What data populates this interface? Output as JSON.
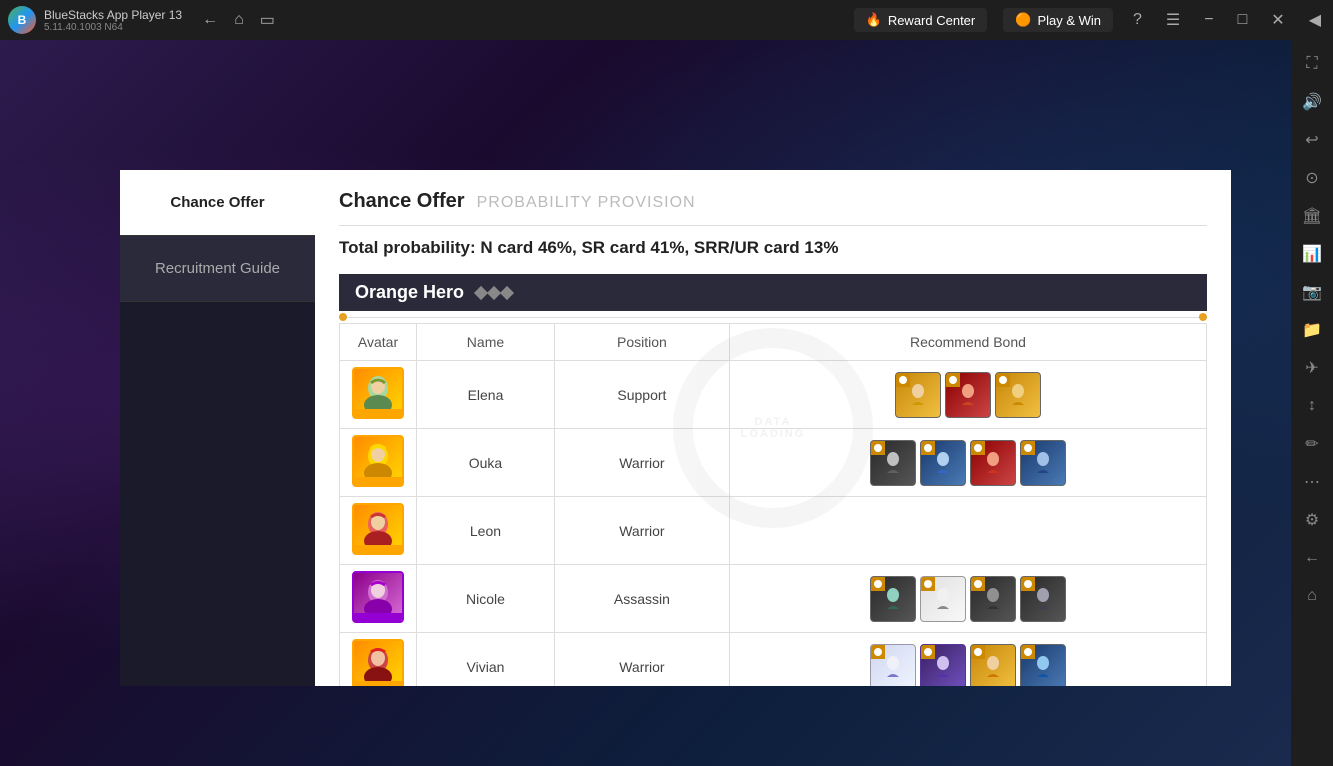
{
  "app": {
    "title": "BlueStacks App Player 13",
    "version": "5.11.40.1003  N64",
    "logo_letter": "B"
  },
  "topbar": {
    "reward_center_label": "Reward Center",
    "play_win_label": "Play & Win",
    "nav_back": "←",
    "nav_home": "⌂",
    "nav_multi": "⧉"
  },
  "right_sidebar": {
    "icons": [
      "⛶",
      "🔊",
      "↩",
      "⊙",
      "🏛",
      "📊",
      "📷",
      "📁",
      "✈",
      "↕",
      "✏",
      "⋯",
      "⚙",
      "←",
      "⌂",
      "🏳"
    ]
  },
  "modal": {
    "left_nav": [
      {
        "label": "Chance Offer",
        "active": true
      },
      {
        "label": "Recruitment Guide",
        "active": false
      }
    ],
    "content": {
      "title": "Chance Offer",
      "subtitle": "PROBABILITY PROVISION",
      "probability": "Total probability: N card 46%, SR card 41%, SRR/UR card 13%",
      "section": {
        "title": "Orange Hero",
        "columns": [
          "Avatar",
          "Name",
          "Position",
          "Recommend Bond"
        ],
        "rows": [
          {
            "name": "Elena",
            "position": "Support",
            "avatar_color": "orange",
            "bond_count": 3
          },
          {
            "name": "Ouka",
            "position": "Warrior",
            "avatar_color": "orange",
            "bond_count": 4
          },
          {
            "name": "Leon",
            "position": "Warrior",
            "avatar_color": "orange",
            "bond_count": 0
          },
          {
            "name": "Nicole",
            "position": "Assassin",
            "avatar_color": "purple",
            "bond_count": 4
          },
          {
            "name": "Vivian",
            "position": "Warrior",
            "avatar_color": "orange",
            "bond_count": 4
          }
        ]
      }
    }
  }
}
